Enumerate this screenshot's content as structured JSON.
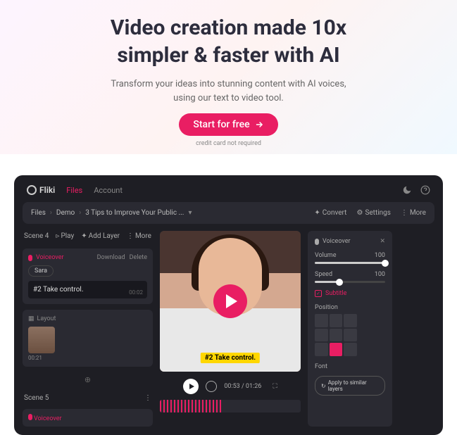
{
  "hero": {
    "title_line1": "Video creation made 10x",
    "title_line2": "simpler & faster with AI",
    "subtitle": "Transform your ideas into stunning content with AI voices, using our text to video tool.",
    "cta_label": "Start for free",
    "disclaimer": "credit card not required"
  },
  "app": {
    "brand": "Fliki",
    "tabs": {
      "files": "Files",
      "account": "Account"
    },
    "breadcrumb": {
      "a": "Files",
      "b": "Demo",
      "c": "3 Tips to Improve Your Public ...",
      "sep": "›"
    },
    "bc_actions": {
      "convert": "Convert",
      "settings": "Settings",
      "more": "More"
    },
    "scene4": {
      "title": "Scene 4",
      "play": "Play",
      "add_layer": "Add Layer",
      "more": "More",
      "voiceover": "Voiceover",
      "download": "Download",
      "delete": "Delete",
      "voice_chip": "Sara",
      "text": "#2 Take control.",
      "text_ts": "00:02",
      "layout": "Layout",
      "thumb_ts": "00:21"
    },
    "scene5": {
      "title": "Scene 5",
      "more": "⋮",
      "voiceover": "Voiceover"
    },
    "player": {
      "caption": "#2 Take control.",
      "time": "00:53 / 01:26"
    },
    "right": {
      "title": "Voiceover",
      "volume": {
        "label": "Volume",
        "value": "100",
        "pct": 100
      },
      "speed": {
        "label": "Speed",
        "value": "100",
        "pct": 35
      },
      "subtitle": "Subtitle",
      "position": "Position",
      "font": "Font",
      "apply": "Apply to similar layers"
    }
  }
}
